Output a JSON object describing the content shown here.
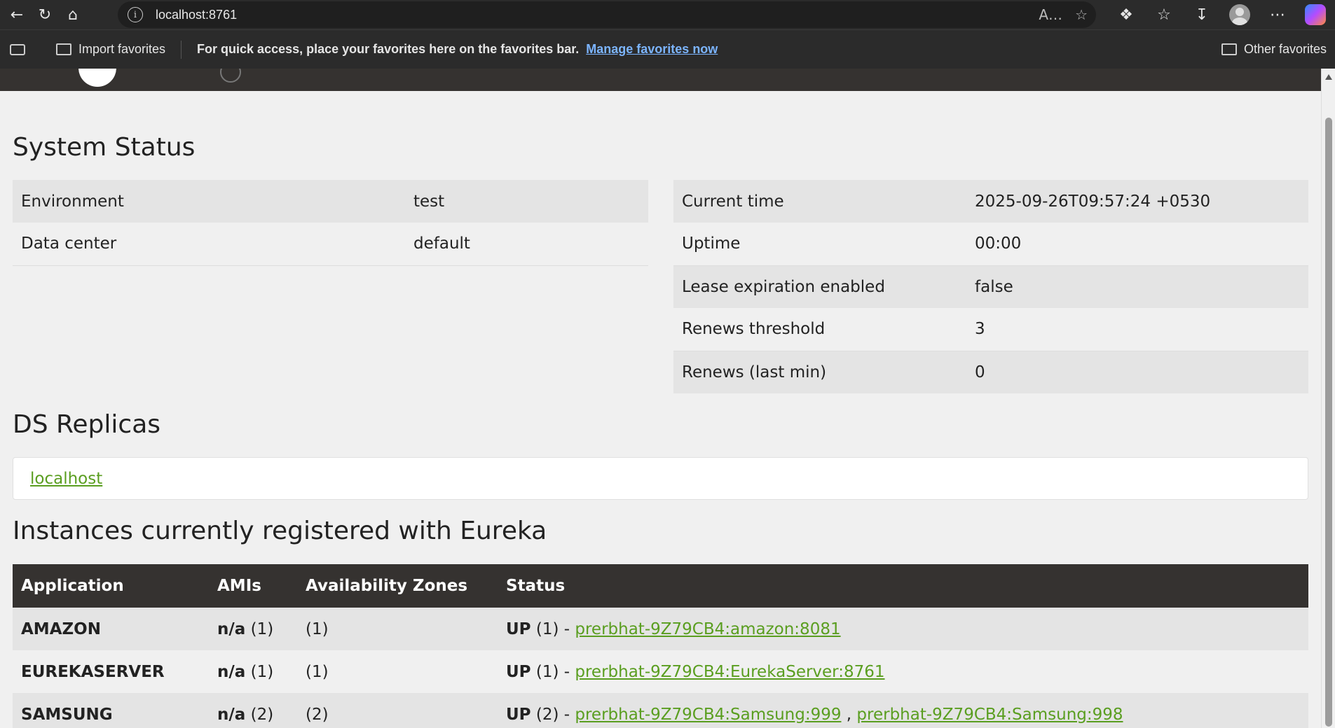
{
  "browser": {
    "url": "localhost:8761",
    "favorites_bar": {
      "import_label": "Import favorites",
      "message": "For quick access, place your favorites here on the favorites bar.",
      "manage_link": "Manage favorites now",
      "other_label": "Other favorites"
    }
  },
  "system_status": {
    "title": "System Status",
    "left": [
      {
        "key": "Environment",
        "value": "test"
      },
      {
        "key": "Data center",
        "value": "default"
      }
    ],
    "right": [
      {
        "key": "Current time",
        "value": "2025-09-26T09:57:24 +0530"
      },
      {
        "key": "Uptime",
        "value": "00:00"
      },
      {
        "key": "Lease expiration enabled",
        "value": "false"
      },
      {
        "key": "Renews threshold",
        "value": "3"
      },
      {
        "key": "Renews (last min)",
        "value": "0"
      }
    ]
  },
  "replicas": {
    "title": "DS Replicas",
    "link": "localhost"
  },
  "instances": {
    "title": "Instances currently registered with Eureka",
    "columns": [
      "Application",
      "AMIs",
      "Availability Zones",
      "Status"
    ],
    "rows": [
      {
        "app": "AMAZON",
        "ami": "n/a",
        "ami_count": "(1)",
        "zones": "(1)",
        "status": "UP",
        "status_count": "(1) -",
        "links": [
          "prerbhat-9Z79CB4:amazon:8081"
        ]
      },
      {
        "app": "EUREKASERVER",
        "ami": "n/a",
        "ami_count": "(1)",
        "zones": "(1)",
        "status": "UP",
        "status_count": "(1) -",
        "links": [
          "prerbhat-9Z79CB4:EurekaServer:8761"
        ]
      },
      {
        "app": "SAMSUNG",
        "ami": "n/a",
        "ami_count": "(2)",
        "zones": "(2)",
        "status": "UP",
        "status_count": "(2) -",
        "links": [
          "prerbhat-9Z79CB4:Samsung:999",
          "prerbhat-9Z79CB4:Samsung:998"
        ],
        "link_separator": ","
      }
    ]
  }
}
